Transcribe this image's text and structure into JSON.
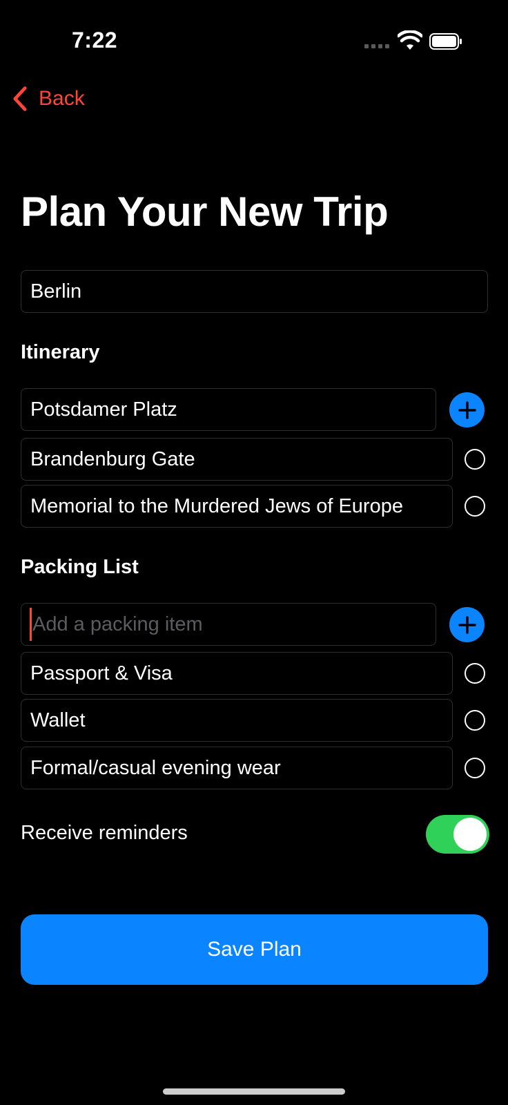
{
  "status_bar": {
    "time": "7:22"
  },
  "nav": {
    "back_label": "Back",
    "back_icon": "chevron-left-icon",
    "accent": "#ff453a"
  },
  "page": {
    "title": "Plan Your New Trip"
  },
  "destination": {
    "value": "Berlin"
  },
  "itinerary": {
    "heading": "Itinerary",
    "new_item_value": "Potsdamer Platz",
    "items": [
      {
        "label": "Brandenburg Gate",
        "checked": false
      },
      {
        "label": "Memorial to the Murdered Jews of Europe",
        "checked": false
      }
    ]
  },
  "packing": {
    "heading": "Packing List",
    "new_item_placeholder": "Add a packing item",
    "items": [
      {
        "label": "Passport & Visa",
        "checked": false
      },
      {
        "label": "Wallet",
        "checked": false
      },
      {
        "label": "Formal/casual evening wear",
        "checked": false
      }
    ]
  },
  "reminders": {
    "label": "Receive reminders",
    "enabled": true,
    "on_color": "#30d158"
  },
  "save_button": {
    "label": "Save Plan",
    "color": "#0a84ff"
  }
}
